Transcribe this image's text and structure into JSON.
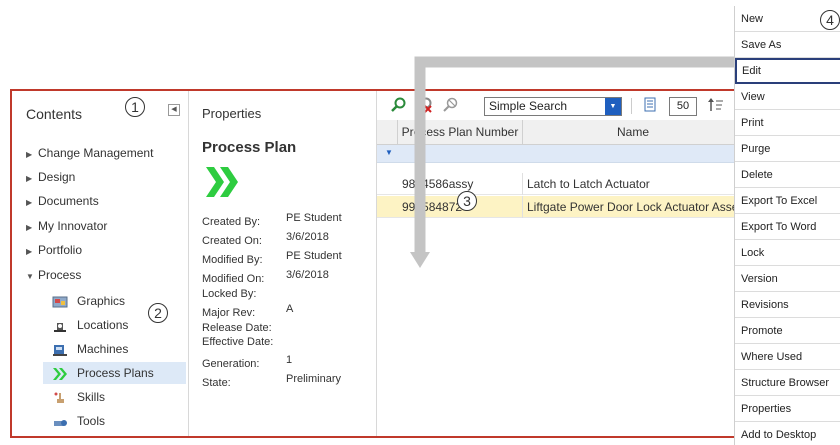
{
  "contents": {
    "header": "Contents",
    "tree": [
      {
        "label": "Change Management",
        "expanded": false
      },
      {
        "label": "Design",
        "expanded": false
      },
      {
        "label": "Documents",
        "expanded": false
      },
      {
        "label": "My Innovator",
        "expanded": false
      },
      {
        "label": "Portfolio",
        "expanded": false
      },
      {
        "label": "Process",
        "expanded": true
      }
    ],
    "sub_items": [
      {
        "label": "Graphics",
        "icon": "graphics-icon"
      },
      {
        "label": "Locations",
        "icon": "locations-icon"
      },
      {
        "label": "Machines",
        "icon": "machines-icon"
      },
      {
        "label": "Process Plans",
        "icon": "process-plans-icon",
        "selected": true
      },
      {
        "label": "Skills",
        "icon": "skills-icon"
      },
      {
        "label": "Tools",
        "icon": "tools-icon"
      }
    ]
  },
  "properties": {
    "header": "Properties",
    "title": "Process Plan",
    "fields": [
      {
        "label": "Created By:",
        "value": "PE Student"
      },
      {
        "label": "Created On:",
        "value": "3/6/2018"
      },
      {
        "label": "Modified By:",
        "value": "PE Student"
      },
      {
        "label": "Modified On:",
        "value": "3/6/2018"
      },
      {
        "label": "Locked By:",
        "value": ""
      },
      {
        "label": "Major Rev:",
        "value": "A"
      },
      {
        "label": "Release Date:",
        "value": ""
      },
      {
        "label": "Effective Date:",
        "value": ""
      },
      {
        "label": "Generation:",
        "value": "1"
      },
      {
        "label": "State:",
        "value": "Preliminary"
      }
    ]
  },
  "grid": {
    "search_mode": "Simple Search",
    "page_size": "50",
    "columns": [
      "Process Plan Number",
      "Name"
    ],
    "rows": [
      {
        "number": "9874586assy",
        "name": "Latch to Latch Actuator",
        "selected": false
      },
      {
        "number": "993584872",
        "name": "Liftgate Power Door Lock Actuator Assembly",
        "selected": true
      }
    ]
  },
  "menu": {
    "items": [
      "New",
      "Save As",
      "Edit",
      "View",
      "Print",
      "Purge",
      "Delete",
      "Export To Excel",
      "Export To Word",
      "Lock",
      "Version",
      "Revisions",
      "Promote",
      "Where Used",
      "Structure Browser",
      "Properties",
      "Add to Desktop"
    ],
    "highlighted": "Edit"
  },
  "callouts": [
    "1",
    "2",
    "3",
    "4"
  ],
  "colors": {
    "frame": "#c0392b",
    "accent": "#1f5fbf",
    "chevron": "#2ecc40",
    "selected_row": "#fdf3c4",
    "selected_nav": "#dde9f7"
  }
}
